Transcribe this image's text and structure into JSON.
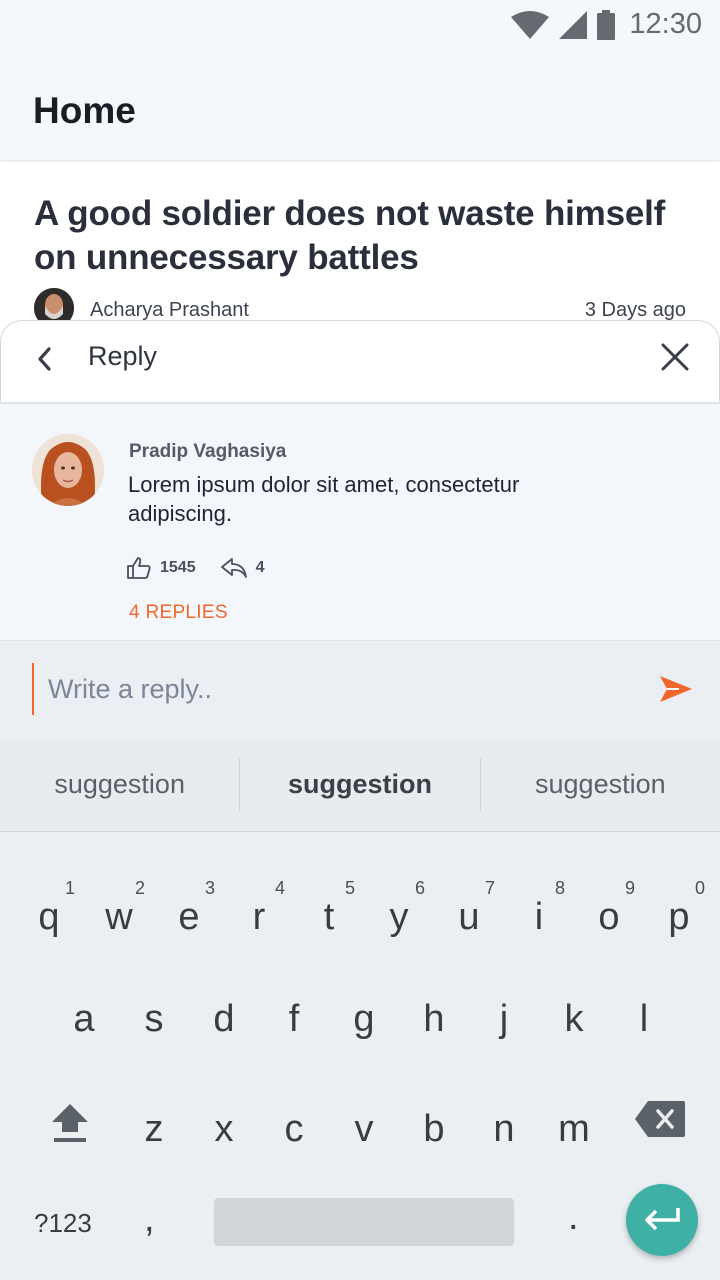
{
  "status_bar": {
    "time": "12:30"
  },
  "app_bar": {
    "title": "Home"
  },
  "article": {
    "title": "A good soldier does not waste himself on unnecessary battles",
    "author": "Acharya Prashant",
    "posted": "3 Days ago"
  },
  "reply_sheet": {
    "title": "Reply",
    "comment": {
      "author": "Pradip Vaghasiya",
      "text": "Lorem ipsum dolor sit amet, consectetur adipiscing.",
      "likes": "1545",
      "replies_count": "4",
      "replies_link": "4 REPLIES"
    },
    "composer": {
      "placeholder": "Write a reply..",
      "accent": "#f0662b"
    }
  },
  "keyboard": {
    "suggestions": [
      "suggestion",
      "suggestion",
      "suggestion"
    ],
    "row1": [
      {
        "letter": "q",
        "hint": "1"
      },
      {
        "letter": "w",
        "hint": "2"
      },
      {
        "letter": "e",
        "hint": "3"
      },
      {
        "letter": "r",
        "hint": "4"
      },
      {
        "letter": "t",
        "hint": "5"
      },
      {
        "letter": "y",
        "hint": "6"
      },
      {
        "letter": "u",
        "hint": "7"
      },
      {
        "letter": "i",
        "hint": "8"
      },
      {
        "letter": "o",
        "hint": "9"
      },
      {
        "letter": "p",
        "hint": "0"
      }
    ],
    "row2": [
      "a",
      "s",
      "d",
      "f",
      "g",
      "h",
      "j",
      "k",
      "l"
    ],
    "row3": [
      "z",
      "x",
      "c",
      "v",
      "b",
      "n",
      "m"
    ],
    "symbols_label": "?123",
    "comma": ",",
    "period": ".",
    "enter_color": "#3eb1a4"
  }
}
